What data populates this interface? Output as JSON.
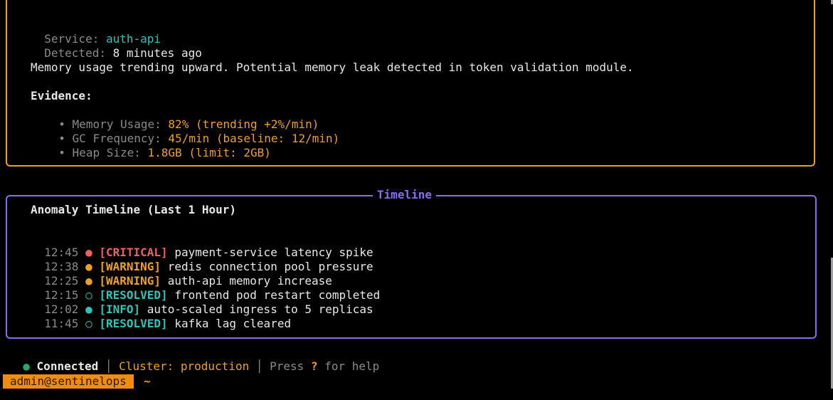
{
  "alert_detail": {
    "service_label": "Service:",
    "service_value": "auth-api",
    "detected_label": "Detected:",
    "detected_value": "8 minutes ago",
    "description": "Memory usage trending upward. Potential memory leak detected in token validation module.",
    "evidence_title": "Evidence:",
    "evidence": [
      {
        "bullet": "•",
        "label": "Memory Usage:",
        "value": "82% (trending +2%/min)"
      },
      {
        "bullet": "•",
        "label": "GC Frequency:",
        "value": "45/min (baseline: 12/min)"
      },
      {
        "bullet": "•",
        "label": "Heap Size:",
        "value": "1.8GB (limit: 2GB)"
      }
    ]
  },
  "timeline": {
    "panel_title": "Timeline",
    "heading": "Anomaly Timeline (Last 1 Hour)",
    "events": [
      {
        "time": "12:45",
        "dot": "●",
        "tag": "[CRITICAL]",
        "text": "payment-service latency spike",
        "severity": "critical"
      },
      {
        "time": "12:38",
        "dot": "●",
        "tag": "[WARNING]",
        "text": "redis connection pool pressure",
        "severity": "warning"
      },
      {
        "time": "12:25",
        "dot": "●",
        "tag": "[WARNING]",
        "text": "auth-api memory increase",
        "severity": "warning"
      },
      {
        "time": "12:15",
        "dot": "○",
        "tag": "[RESOLVED]",
        "text": "frontend pod restart completed",
        "severity": "resolved"
      },
      {
        "time": "12:02",
        "dot": "●",
        "tag": "[INFO]",
        "text": "auto-scaled ingress to 5 replicas",
        "severity": "info"
      },
      {
        "time": "11:45",
        "dot": "○",
        "tag": "[RESOLVED]",
        "text": "kafka lag cleared",
        "severity": "resolved"
      }
    ]
  },
  "status_bar": {
    "connection_dot": "●",
    "connection_text": "Connected",
    "separator": "│",
    "cluster_label": "Cluster:",
    "cluster_value": "production",
    "help_prefix": "Press",
    "help_key": "?",
    "help_suffix": "for help"
  },
  "prompt": {
    "user": "admin@sentinelops",
    "path": "~"
  },
  "colors": {
    "accent_orange": "#f0a020",
    "accent_purple": "#8b6cf0",
    "critical": "#f06060",
    "warning": "#f0a020",
    "resolved": "#2ec4b6",
    "info": "#2ec4b6",
    "connected": "#22aa66"
  }
}
